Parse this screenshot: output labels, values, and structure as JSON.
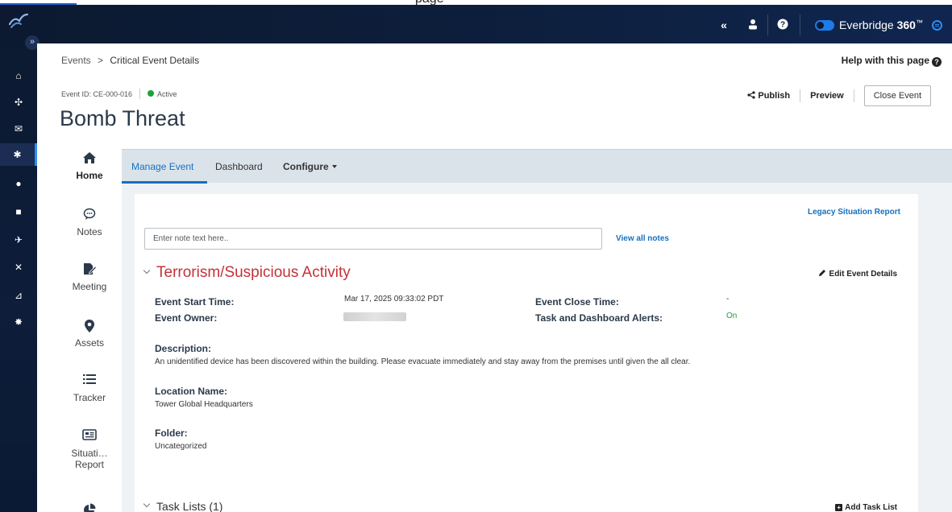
{
  "browser": {
    "page_fragment": "page"
  },
  "header": {
    "brand_name": "Everbridge ",
    "brand_bold": "360",
    "brand_sup": "™",
    "icons": [
      "collapse-double-chevron-icon",
      "user-icon",
      "help-icon",
      "toggle-switch-icon",
      "menu-circle-icon"
    ]
  },
  "rail": {
    "expand_glyph": "»",
    "items": [
      {
        "icon": "home-icon",
        "glyph": "⌂"
      },
      {
        "icon": "group-icon",
        "glyph": "✣"
      },
      {
        "icon": "megaphone-icon",
        "glyph": "✉"
      },
      {
        "icon": "critical-event-icon",
        "glyph": "✱",
        "active": true
      },
      {
        "icon": "location-pin-icon",
        "glyph": "●"
      },
      {
        "icon": "report-icon",
        "glyph": "■"
      },
      {
        "icon": "airplane-icon",
        "glyph": "✈"
      },
      {
        "icon": "flow-icon",
        "glyph": "✕"
      },
      {
        "icon": "analytics-chart-icon",
        "glyph": "⊿"
      },
      {
        "icon": "settings-gear-icon",
        "glyph": "✸"
      }
    ]
  },
  "breadcrumb": {
    "parent": "Events",
    "separator": ">",
    "current": "Critical Event Details"
  },
  "help": {
    "label": "Help with this page",
    "icon_glyph": "?"
  },
  "event": {
    "id_label": "Event ID: CE-000-016",
    "status": "Active",
    "title": "Bomb Threat"
  },
  "actions": {
    "publish": "Publish",
    "preview": "Preview",
    "close": "Close Event"
  },
  "side_menu": {
    "items": [
      {
        "label": "Home",
        "icon": "home-icon",
        "glyph": "⌂",
        "active": true
      },
      {
        "label": "Notes",
        "icon": "chat-bubble-icon",
        "glyph": "◌"
      },
      {
        "label": "Meeting",
        "icon": "meeting-edit-icon",
        "glyph": "✎"
      },
      {
        "label": "Assets",
        "icon": "map-pin-icon",
        "glyph": "●"
      },
      {
        "label": "Tracker",
        "icon": "list-icon",
        "glyph": "☰"
      },
      {
        "label": "Situati…",
        "label2": "Report",
        "icon": "newspaper-icon",
        "glyph": "▤"
      },
      {
        "label": "",
        "icon": "pie-chart-icon",
        "glyph": "◕"
      }
    ]
  },
  "tabs": [
    {
      "label": "Manage Event",
      "active": true
    },
    {
      "label": "Dashboard"
    },
    {
      "label": "Configure"
    }
  ],
  "card": {
    "legacy_link": "Legacy Situation Report",
    "note_placeholder": "Enter note text here..",
    "view_notes": "View all notes",
    "section_title": "Terrorism/Suspicious Activity",
    "edit_details": "Edit Event Details",
    "fields": {
      "start_label": "Event Start Time:",
      "start_value": "Mar 17, 2025 09:33:02 PDT",
      "close_label": "Event Close Time:",
      "close_value": "-",
      "owner_label": "Event Owner:",
      "alerts_label": "Task and Dashboard Alerts:",
      "alerts_value": "On",
      "description_label": "Description:",
      "description_value": "An unidentified device has been discovered within the building. Please evacuate immediately and stay away from the premises until given the all clear.",
      "location_label": "Location Name:",
      "location_value": "Tower Global Headquarters",
      "folder_label": "Folder:",
      "folder_value": "Uncategorized"
    },
    "task_lists_title": "Task Lists (1)",
    "add_task_list": "Add Task List"
  },
  "colors": {
    "accent_blue": "#1670c2",
    "section_red": "#c4323a",
    "status_green": "#1aa33a",
    "nav_dark": "#0c1930"
  }
}
